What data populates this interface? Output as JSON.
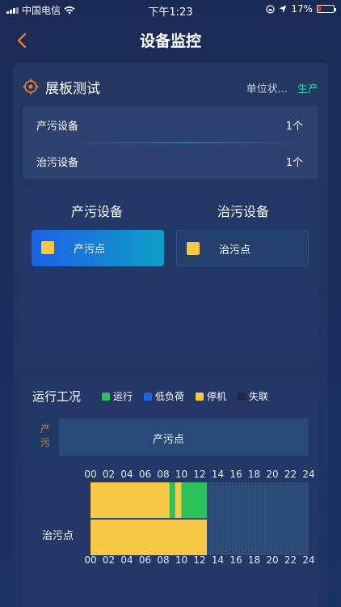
{
  "status_bar": {
    "carrier": "中国电信",
    "time": "下午1:23",
    "battery": "17%",
    "battery_level": 0.17
  },
  "nav": {
    "title": "设备监控"
  },
  "card": {
    "title": "展板测试",
    "unit_label": "单位状...",
    "unit_value": "生产"
  },
  "summary": [
    {
      "label": "产污设备",
      "value": "1个"
    },
    {
      "label": "治污设备",
      "value": "1个"
    }
  ],
  "devices": {
    "left_title": "产污设备",
    "right_title": "治污设备",
    "left_item": "产污点",
    "right_item": "治污点"
  },
  "status": {
    "title": "运行工况",
    "legend": [
      {
        "label": "运行",
        "color": "#2bc25a"
      },
      {
        "label": "低负荷",
        "color": "#1565e6"
      },
      {
        "label": "停机",
        "color": "#f7c846"
      },
      {
        "label": "失联",
        "color": "#1e2a44"
      }
    ],
    "prod_tag": "产\n污",
    "prod_label": "产污点",
    "row_label": "治污点",
    "hours": [
      "00",
      "02",
      "04",
      "06",
      "08",
      "10",
      "12",
      "14",
      "16",
      "18",
      "20",
      "22",
      "24"
    ]
  },
  "colors": {
    "accent": "#e67e2a",
    "running": "#2bc25a",
    "stopped": "#f7c846",
    "idle_bg": "#2a4a75",
    "unit_value": "#2ed3a8"
  },
  "timeline_data": {
    "top_row": [
      {
        "start": 0,
        "end": 8.7,
        "state": "停机"
      },
      {
        "start": 8.7,
        "end": 9.3,
        "state": "运行"
      },
      {
        "start": 9.3,
        "end": 10.0,
        "state": "停机"
      },
      {
        "start": 10.0,
        "end": 12.8,
        "state": "运行"
      }
    ],
    "bottom_row": [
      {
        "start": 0,
        "end": 12.8,
        "state": "停机"
      }
    ]
  }
}
